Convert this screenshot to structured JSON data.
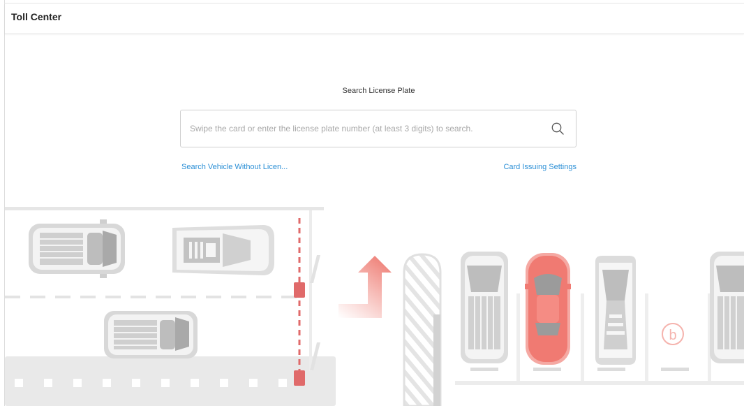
{
  "header": {
    "title": "Toll Center"
  },
  "search": {
    "label": "Search License Plate",
    "placeholder": "Swipe the card or enter the license plate number (at least 3 digits) to search.",
    "value": ""
  },
  "links": {
    "search_without_plate": "Search Vehicle Without Licen...",
    "card_issuing_settings": "Card Issuing Settings"
  },
  "colors": {
    "accent": "#2b8fd6",
    "barrier_red": "#e06a6a",
    "highlight_car": "#f07a72"
  },
  "icons": {
    "search": "search-icon",
    "parking_sign": "parking-b-icon"
  },
  "parking_sign_letter": "b"
}
